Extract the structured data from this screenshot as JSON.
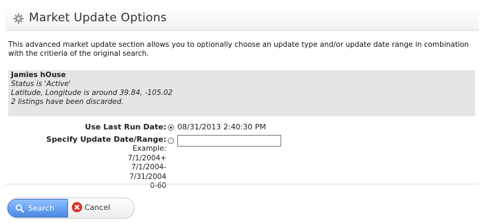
{
  "header": {
    "title": "Market Update Options",
    "icon": "gear-icon"
  },
  "intro": "This advanced market update section allows you to optionally choose an update type and/or update date range in combination with the critieria of the original search.",
  "summary": {
    "name": "Jamies hOuse",
    "status": "Status is 'Active'",
    "location": "Latitude, Longitude is around 39.84, -105.02",
    "discarded": "2 listings have been discarded."
  },
  "options": {
    "last_run_label": "Use Last Run Date:",
    "last_run_value": "08/31/2013 2:40:30 PM",
    "last_run_selected": true,
    "range_label": "Specify Update Date/Range:",
    "range_selected": false,
    "range_value": "",
    "example_lines": [
      "Example: 7/1/2004+",
      "7/1/2004-7/31/2004",
      "0-60"
    ]
  },
  "buttons": {
    "search_label": "Search",
    "cancel_label": "Cancel"
  },
  "colors": {
    "search_button": "#4a87e4",
    "cancel_icon": "#d9342b",
    "summary_background": "#e6e6e6"
  }
}
